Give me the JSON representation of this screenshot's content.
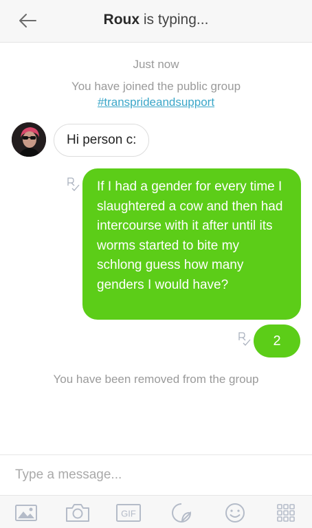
{
  "header": {
    "name": "Roux",
    "status": " is typing..."
  },
  "system": {
    "timestamp": "Just now",
    "joined_text": "You have joined the public group",
    "group_hashtag": "#transprideandsupport",
    "removed_text": "You have been removed from the group"
  },
  "messages": {
    "incoming_1": "Hi person c:",
    "outgoing_1": "If I had a gender for every time I slaughtered a cow and then had intercourse with it after until its worms started to bite my schlong guess how many genders I would have?",
    "outgoing_2": "2"
  },
  "composer": {
    "placeholder": "Type a message..."
  },
  "toolbar": {
    "gif_label": "GIF",
    "icons": [
      "image-icon",
      "camera-icon",
      "gif-icon",
      "sticker-icon",
      "emoji-icon",
      "apps-grid-icon"
    ]
  },
  "colors": {
    "outgoing_bubble": "#5ccd18",
    "hashtag": "#3aa6c8",
    "system_text": "#9a9a9a",
    "icon_gray": "#b4bbc8"
  }
}
